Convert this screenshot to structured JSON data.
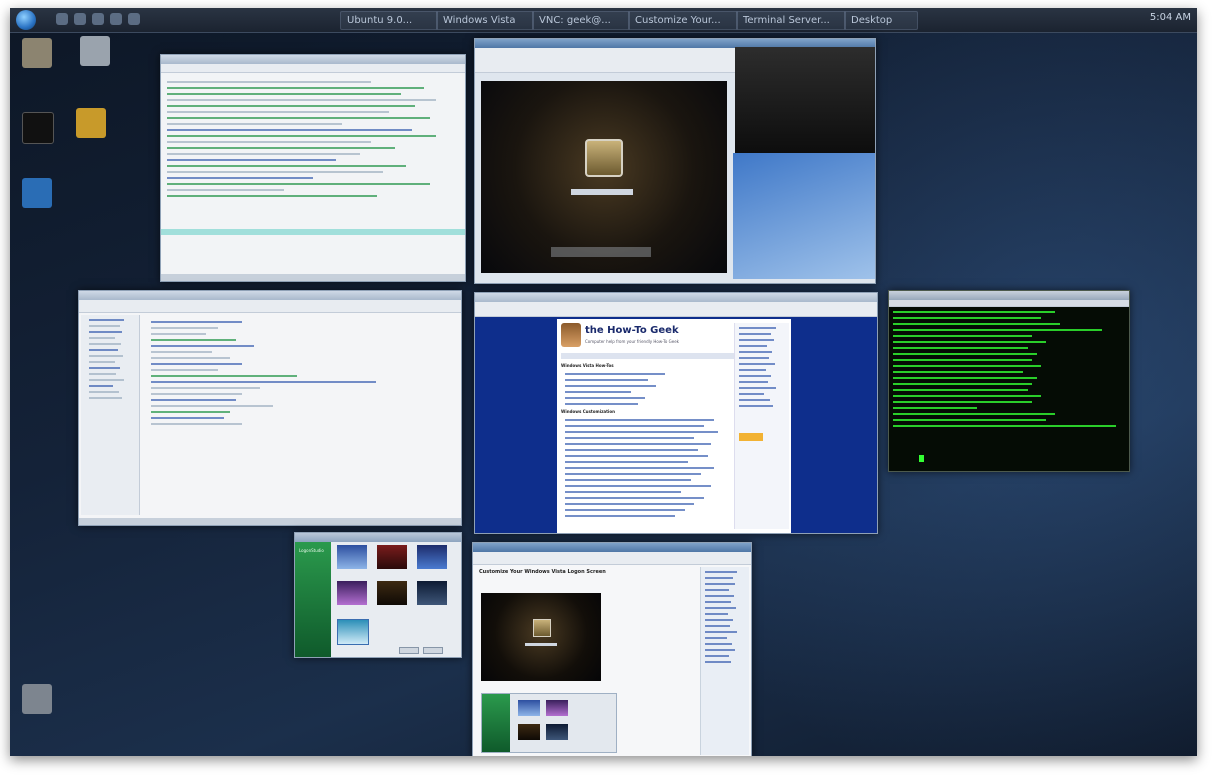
{
  "colors": {
    "desktop": "#142238",
    "terminal_bg": "#050c05",
    "terminal_text": "#33ff33",
    "browser_blue": "#0e2e8c",
    "vista_green": "#1f7a3f"
  },
  "taskbar": {
    "start_icon": "windows-orb-icon",
    "tasks": [
      "Ubuntu 9.0...",
      "Windows Vista",
      "VNC: geek@...",
      "Customize Your...",
      "Terminal Server...",
      "Desktop"
    ],
    "clock": "5:04 AM"
  },
  "browser": {
    "site_title": "the How-To Geek",
    "tagline": "Computer help from your friendly How-To Geek",
    "heading1": "Windows Vista How-Tos",
    "heading2": "Windows Customization"
  },
  "customize_page": {
    "heading": "Customize Your Windows Vista Logon Screen"
  },
  "logon_app": {
    "title": "LogonStudio"
  }
}
